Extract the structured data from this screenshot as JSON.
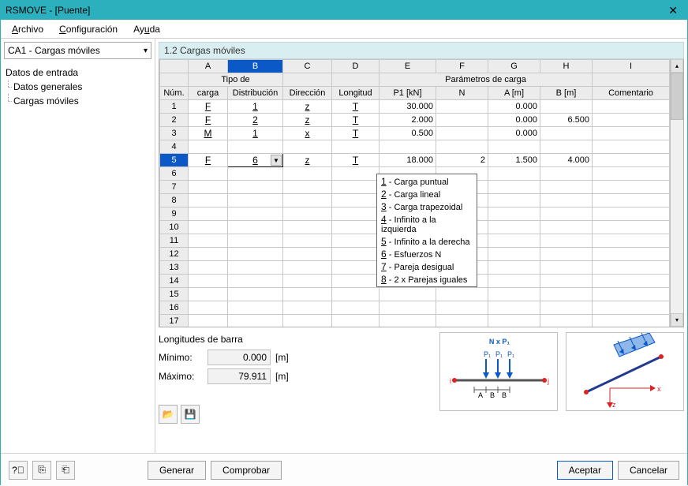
{
  "title": "RSMOVE - [Puente]",
  "menu": {
    "file": "Archivo",
    "config": "Configuración",
    "help": "Ayuda"
  },
  "combo": "CA1 - Cargas móviles",
  "tree": {
    "root": "Datos de entrada",
    "c1": "Datos generales",
    "c2": "Cargas móviles"
  },
  "panel_title": "1.2 Cargas móviles",
  "headers": {
    "cols": [
      "A",
      "B",
      "C",
      "D",
      "E",
      "F",
      "G",
      "H",
      "I"
    ],
    "group_tipo": "Tipo de",
    "group_param": "Parámetros de carga",
    "num": "Núm.",
    "carga": "carga",
    "distrib": "Distribución",
    "direccion": "Dirección",
    "longitud": "Longitud",
    "p1": "P1 [kN]",
    "n": "N",
    "a": "A [m]",
    "b": "B [m]",
    "comentario": "Comentario"
  },
  "rows": [
    {
      "num": "1",
      "carga": "F",
      "dist": "1",
      "dir": "z",
      "long": "T",
      "p1": "30.000",
      "n": "",
      "a": "0.000",
      "b": "",
      "com": ""
    },
    {
      "num": "2",
      "carga": "F",
      "dist": "2",
      "dir": "z",
      "long": "T",
      "p1": "2.000",
      "n": "",
      "a": "0.000",
      "b": "6.500",
      "com": ""
    },
    {
      "num": "3",
      "carga": "M",
      "dist": "1",
      "dir": "x",
      "long": "T",
      "p1": "0.500",
      "n": "",
      "a": "0.000",
      "b": "",
      "com": ""
    },
    {
      "num": "4",
      "carga": "",
      "dist": "",
      "dir": "",
      "long": "",
      "p1": "",
      "n": "",
      "a": "",
      "b": "",
      "com": ""
    },
    {
      "num": "5",
      "carga": "F",
      "dist": "6",
      "dir": "z",
      "long": "T",
      "p1": "18.000",
      "n": "2",
      "a": "1.500",
      "b": "4.000",
      "com": ""
    }
  ],
  "dropdown": [
    "1 - Carga puntual",
    "2 - Carga lineal",
    "3 - Carga trapezoidal",
    "4 - Infinito a la izquierda",
    "5 - Infinito a la derecha",
    "6 - Esfuerzos N",
    "7 - Pareja desigual",
    "8 - 2 x Parejas iguales"
  ],
  "longitudes": {
    "title": "Longitudes de barra",
    "min_lbl": "Mínimo:",
    "min_val": "0.000",
    "min_unit": "[m]",
    "max_lbl": "Máximo:",
    "max_val": "79.911",
    "max_unit": "[m]"
  },
  "preview1": {
    "NxP1": "N x P₁",
    "P1": "P₁",
    "i": "i",
    "j": "j",
    "A": "A",
    "B": "B"
  },
  "preview2": {
    "x": "x",
    "z": "z"
  },
  "buttons": {
    "generar": "Generar",
    "comprobar": "Comprobar",
    "aceptar": "Aceptar",
    "cancelar": "Cancelar"
  }
}
